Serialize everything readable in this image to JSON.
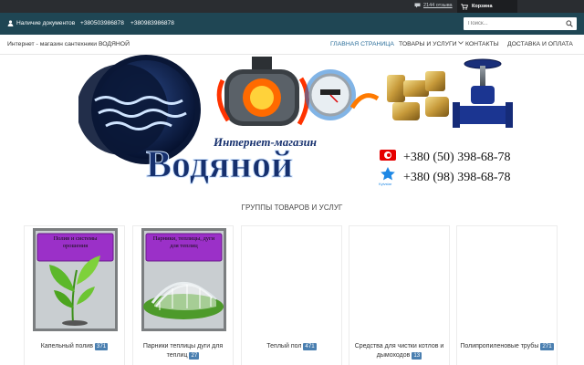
{
  "topbar": {
    "reviews_label": "2144 отзыва",
    "cart_label": "Корзина"
  },
  "infobar": {
    "docs_label": "Наличие документов",
    "phone1": "+380503986878",
    "phone2": "+380983986878"
  },
  "search": {
    "placeholder": "Поиск..."
  },
  "nav": {
    "shop_name": "Интернет - магазин сантехники ВОДЯНОЙ",
    "items": [
      {
        "label": "ГЛАВНАЯ СТРАНИЦА"
      },
      {
        "label": "ТОВАРЫ И УСЛУГИ"
      },
      {
        "label": "КОНТАКТЫ"
      },
      {
        "label": "ДОСТАВКА И ОПЛАТА"
      }
    ]
  },
  "banner": {
    "subtitle": "Интернет-магазин",
    "brand": "Водяной",
    "phone1": "+380 (50) 398-68-78",
    "phone2": "+380 (98) 398-68-78",
    "operator2": "Kyivstar"
  },
  "section": {
    "title": "ГРУППЫ ТОВАРОВ И УСЛУГ"
  },
  "cards": [
    {
      "label": "Капельный полив",
      "count": "371",
      "img_text": "Полив и системы орошения"
    },
    {
      "label": "Парники теплицы дуги для теплиц",
      "count": "27",
      "img_text": "Парники, теплицы, дуги для теплиц"
    },
    {
      "label": "Теплый пол",
      "count": "471"
    },
    {
      "label": "Средства для чистки котлов и дымоходов",
      "count": "13"
    },
    {
      "label": "Полипропиленовые трубы",
      "count": "271"
    }
  ],
  "colors": {
    "infobar": "#1f4654",
    "topbar": "#2a2d31",
    "nav_active": "#2b6e9a",
    "badge": "#4a7fb0",
    "card_label_bg": "#9b30c8"
  }
}
